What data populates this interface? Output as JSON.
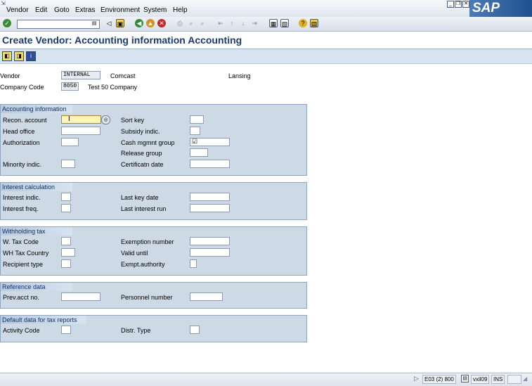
{
  "menubar": {
    "items": [
      "Vendor",
      "Edit",
      "Goto",
      "Extras",
      "Environment",
      "System",
      "Help"
    ],
    "logo": "SAP"
  },
  "toolbar": {
    "command_field_value": "",
    "icons": [
      "enter-icon",
      "save-icon",
      "back-icon",
      "exit-icon",
      "cancel-icon",
      "print-icon",
      "find-icon",
      "find-next-icon",
      "first-page-icon",
      "previous-page-icon",
      "next-page-icon",
      "last-page-icon",
      "create-session-icon",
      "shortcut-icon",
      "help-icon",
      "layout-icon"
    ]
  },
  "title": "Create Vendor: Accounting information Accounting",
  "header": {
    "vendor_label": "Vendor",
    "vendor_value": "INTERNAL",
    "vendor_name": "Comcast",
    "vendor_city": "Lansing",
    "company_code_label": "Company Code",
    "company_code_value": "8050",
    "company_name": "Test 50 Company"
  },
  "groups": {
    "accounting": {
      "title": "Accounting information",
      "recon_account": "Recon. account",
      "head_office": "Head office",
      "authorization": "Authorization",
      "minority_indic": "Minority indic.",
      "sort_key": "Sort key",
      "subsidy_indic": "Subsidy indic.",
      "cash_mgmnt_group": "Cash mgmnt group",
      "cash_mgmnt_value": "☑",
      "release_group": "Release group",
      "certificatn_date": "Certificatn date"
    },
    "interest": {
      "title": "Interest calculation",
      "interest_indic": "Interest indic.",
      "interest_freq": "Interest freq.",
      "last_key_date": "Last key date",
      "last_interest_run": "Last interest run"
    },
    "withholding": {
      "title": "Withholding tax",
      "w_tax_code": "W. Tax Code",
      "wh_tax_country": "WH Tax Country",
      "recipient_type": "Recipient type",
      "exemption_number": "Exemption number",
      "valid_until": "Valid until",
      "exmpt_authority": "Exmpt.authority"
    },
    "reference": {
      "title": "Reference data",
      "prev_acct_no": "Prev.acct no.",
      "personnel_number": "Personnel number"
    },
    "tax_reports": {
      "title": "Default data for tax reports",
      "activity_code": "Activity Code",
      "distr_type": "Distr. Type"
    }
  },
  "statusbar": {
    "transaction": "E03 (2) 800",
    "server": "vxil09",
    "mode": "INS"
  },
  "colors": {
    "title": "#1a3a72",
    "group_bg": "#ced9e6",
    "active_field": "#fff4b8"
  }
}
